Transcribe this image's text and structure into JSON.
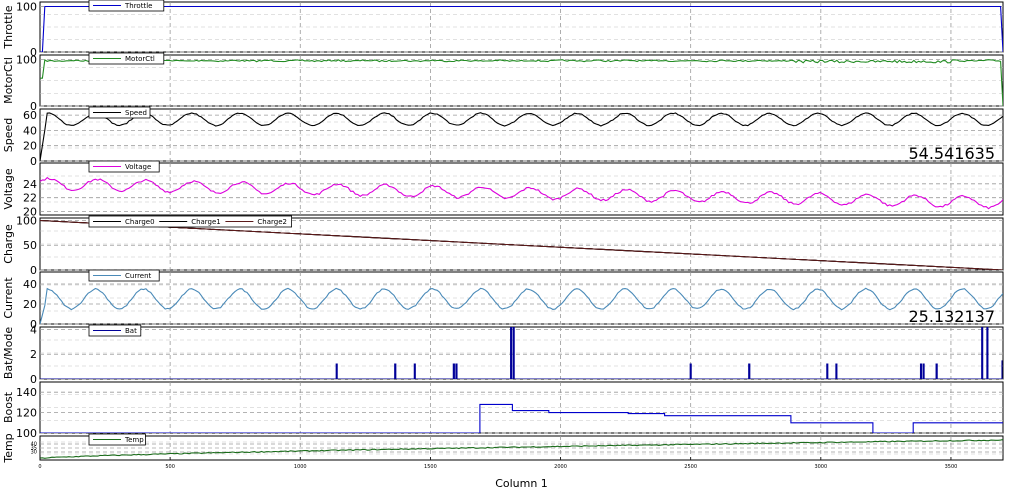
{
  "xlabel": "Column 1",
  "x_ticks": [
    "0",
    "500",
    "1000",
    "1500",
    "2000",
    "2500",
    "3000",
    "3500"
  ],
  "x_tick_values": [
    0,
    500,
    1000,
    1500,
    2000,
    2500,
    3000,
    3500
  ],
  "xlim": [
    0,
    3700
  ],
  "grid": true,
  "chart_data": [
    {
      "type": "line",
      "ylabel": "Throttle",
      "ylim": [
        0,
        110
      ],
      "y_ticks": [
        "0",
        "100"
      ],
      "y_tick_values": [
        0,
        100
      ],
      "legend": "top-left",
      "series": [
        {
          "name": "Throttle",
          "color": "#0000cc",
          "pattern": "step_to_level",
          "level": 100
        }
      ],
      "readout": ""
    },
    {
      "type": "line",
      "ylabel": "MotorCtl",
      "ylim": [
        0,
        110
      ],
      "y_ticks": [
        "0",
        "100"
      ],
      "y_tick_values": [
        0,
        100
      ],
      "legend": "top-left",
      "series": [
        {
          "name": "MotorCtl",
          "color": "#228b22",
          "pattern": "near_level_noisy",
          "level": 100
        }
      ],
      "readout": ""
    },
    {
      "type": "line",
      "ylabel": "Speed",
      "ylim": [
        0,
        68
      ],
      "y_ticks": [
        "0",
        "20",
        "40",
        "60"
      ],
      "y_tick_values": [
        0,
        20,
        40,
        60
      ],
      "legend": "top-left",
      "series": [
        {
          "name": "Speed",
          "color": "#000000",
          "pattern": "oscillating",
          "center": 54.5,
          "amplitude": 8,
          "cycles": 20
        }
      ],
      "readout": "54.541635"
    },
    {
      "type": "line",
      "ylabel": "Voltage",
      "ylim": [
        19.5,
        27
      ],
      "y_ticks": [
        "20",
        "22",
        "24"
      ],
      "y_tick_values": [
        20,
        22,
        24
      ],
      "legend": "top-left",
      "series": [
        {
          "name": "Voltage",
          "color": "#dd00dd",
          "pattern": "oscillating_decaying",
          "start": 24,
          "end": 21.3,
          "amplitude": 0.8,
          "cycles": 20
        }
      ],
      "readout": ""
    },
    {
      "type": "line",
      "ylabel": "Charge",
      "ylim": [
        0,
        105
      ],
      "y_ticks": [
        "0",
        "50",
        "100"
      ],
      "y_tick_values": [
        0,
        50,
        100
      ],
      "legend": "top-left",
      "series": [
        {
          "name": "Charge0",
          "color": "#000000",
          "pattern": "linear",
          "start": 100,
          "end": 0
        },
        {
          "name": "Charge1",
          "color": "#000000",
          "pattern": "linear",
          "start": 100,
          "end": 0
        },
        {
          "name": "Charge2",
          "color": "#5b1a1a",
          "pattern": "linear",
          "start": 100,
          "end": 0
        }
      ],
      "readout": ""
    },
    {
      "type": "line",
      "ylabel": "Current",
      "ylim": [
        0,
        52
      ],
      "y_ticks": [
        "0",
        "20",
        "40"
      ],
      "y_tick_values": [
        0,
        20,
        40
      ],
      "legend": "top-left",
      "series": [
        {
          "name": "Current",
          "color": "#4a8ab8",
          "pattern": "oscillating",
          "center": 25,
          "amplitude": 10,
          "cycles": 20
        }
      ],
      "readout": "25.132137"
    },
    {
      "type": "line",
      "ylabel": "Bat/Mode",
      "ylim": [
        0,
        4.2
      ],
      "y_ticks": [
        "0",
        "2",
        "4"
      ],
      "y_tick_values": [
        0,
        2,
        4
      ],
      "legend": "top-left",
      "series": [
        {
          "name": "Bat",
          "color": "#000099",
          "pattern": "spikes",
          "spikes": [
            [
              1140,
              1.2
            ],
            [
              1365,
              1.2
            ],
            [
              1440,
              1.2
            ],
            [
              1590,
              1.2
            ],
            [
              1600,
              1.2
            ],
            [
              1810,
              4.2
            ],
            [
              1820,
              4.2
            ],
            [
              2500,
              1.2
            ],
            [
              2725,
              1.2
            ],
            [
              3025,
              1.2
            ],
            [
              3060,
              1.2
            ],
            [
              3385,
              1.2
            ],
            [
              3395,
              1.2
            ],
            [
              3445,
              1.2
            ],
            [
              3620,
              4.2
            ],
            [
              3640,
              4.2
            ]
          ]
        }
      ],
      "readout": ""
    },
    {
      "type": "line",
      "ylabel": "Boost",
      "ylim": [
        100,
        150
      ],
      "y_ticks": [
        "100",
        "120",
        "140"
      ],
      "y_tick_values": [
        100,
        120,
        140
      ],
      "legend": "none",
      "series": [
        {
          "name": "",
          "color": "#0000cc",
          "pattern": "steps",
          "steps": [
            [
              0,
              100
            ],
            [
              1690,
              128
            ],
            [
              1815,
              122
            ],
            [
              1955,
              120
            ],
            [
              2260,
              119
            ],
            [
              2400,
              117
            ],
            [
              2885,
              110
            ],
            [
              3200,
              100
            ],
            [
              3355,
              110
            ],
            [
              3700,
              110
            ]
          ]
        }
      ],
      "readout": ""
    },
    {
      "type": "line",
      "ylabel": "Temp",
      "ylim": [
        20,
        50
      ],
      "y_ticks": [
        "30",
        "35",
        "40"
      ],
      "y_tick_values": [
        30,
        35,
        40
      ],
      "legend": "top-left",
      "series": [
        {
          "name": "Temp",
          "color": "#1a6b1a",
          "pattern": "rising",
          "start": 22,
          "end": 45
        }
      ],
      "readout": ""
    }
  ]
}
